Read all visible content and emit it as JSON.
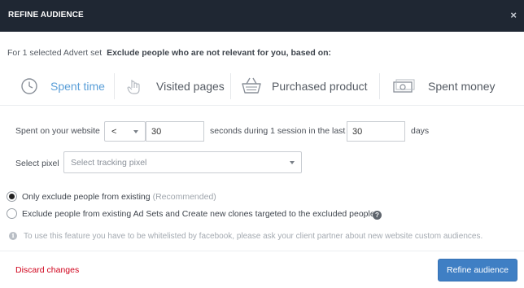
{
  "dialog": {
    "title": "REFINE AUDIENCE",
    "close_symbol": "×"
  },
  "context": {
    "prefix": "For 1 selected Advert set",
    "instruction": "Exclude people who are not relevant for you, based on:"
  },
  "tabs": [
    {
      "label": "Spent time",
      "icon": "clock-icon",
      "active": true
    },
    {
      "label": "Visited pages",
      "icon": "hand-pointer-icon",
      "active": false
    },
    {
      "label": "Purchased product",
      "icon": "basket-icon",
      "active": false
    },
    {
      "label": "Spent money",
      "icon": "money-icon",
      "active": false
    }
  ],
  "spent_row": {
    "label": "Spent on your website",
    "operator": "<",
    "seconds_value": "30",
    "middle_text": "seconds during 1 session in the last",
    "days_value": "30",
    "days_label": "days"
  },
  "pixel_row": {
    "label": "Select pixel",
    "placeholder": "Select tracking pixel"
  },
  "options": [
    {
      "label": "Only exclude people from existing",
      "note": "(Recommended)",
      "selected": true
    },
    {
      "label": "Exclude people from existing Ad Sets and Create new clones targeted to the excluded people",
      "selected": false
    }
  ],
  "info_note": "To use this feature you have to be whitelisted by facebook, please ask your client partner about new website custom audiences.",
  "footer": {
    "discard_label": "Discard changes",
    "submit_label": "Refine audience"
  },
  "colors": {
    "titlebar": "#1f2733",
    "active_tab": "#5b9fd8",
    "primary_button": "#3f7fc4",
    "discard": "#d0021b"
  }
}
